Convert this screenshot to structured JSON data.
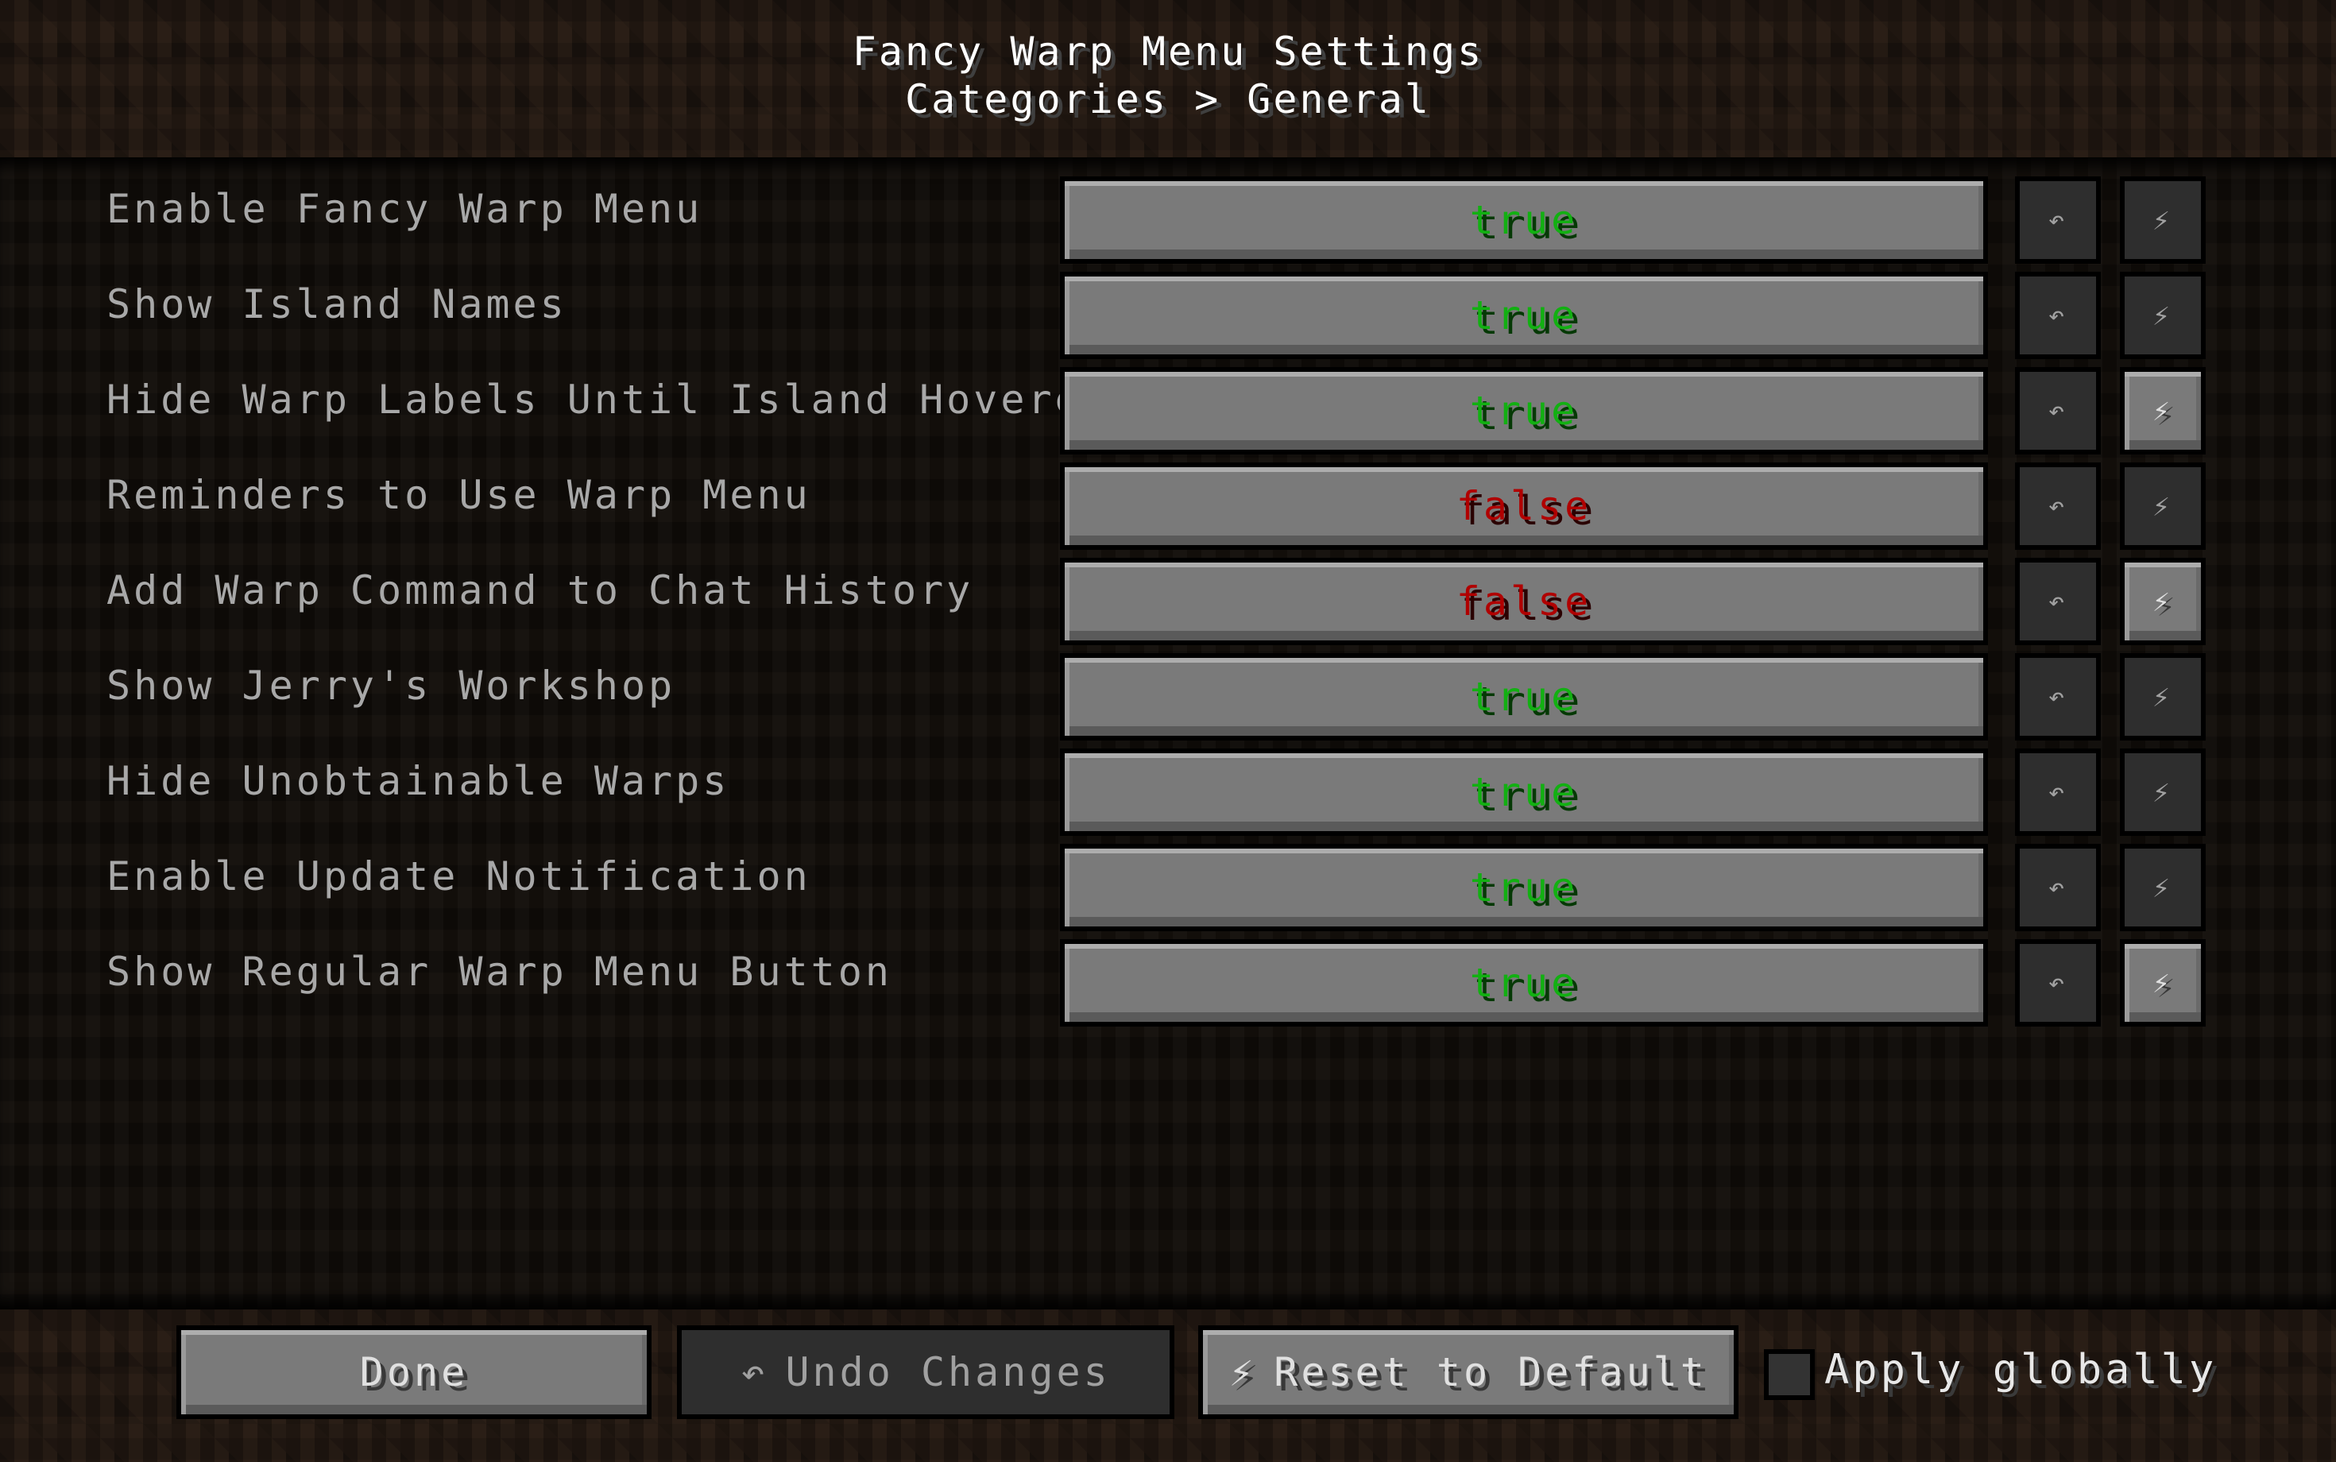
{
  "header": {
    "title": "Fancy Warp Menu Settings",
    "breadcrumb": "Categories > General"
  },
  "icons": {
    "undo": "↶",
    "reset": "⚡"
  },
  "settings": [
    {
      "label": "Enable Fancy Warp Menu",
      "value": "true",
      "reset_enabled": false
    },
    {
      "label": "Show Island Names",
      "value": "true",
      "reset_enabled": false
    },
    {
      "label": "Hide Warp Labels Until Island Hovered",
      "value": "true",
      "reset_enabled": true
    },
    {
      "label": "Reminders to Use Warp Menu",
      "value": "false",
      "reset_enabled": false
    },
    {
      "label": "Add Warp Command to Chat History",
      "value": "false",
      "reset_enabled": true
    },
    {
      "label": "Show Jerry's Workshop",
      "value": "true",
      "reset_enabled": false
    },
    {
      "label": "Hide Unobtainable Warps",
      "value": "true",
      "reset_enabled": false
    },
    {
      "label": "Enable Update Notification",
      "value": "true",
      "reset_enabled": false
    },
    {
      "label": "Show Regular Warp Menu Button",
      "value": "true",
      "reset_enabled": true
    }
  ],
  "footer": {
    "done_label": "Done",
    "undo_label": "Undo Changes",
    "reset_label": "Reset to Default",
    "apply_globally_label": "Apply globally",
    "apply_globally_checked": false
  },
  "colors": {
    "true": "#12b012",
    "false": "#b00000",
    "label": "#a8a8a8"
  }
}
